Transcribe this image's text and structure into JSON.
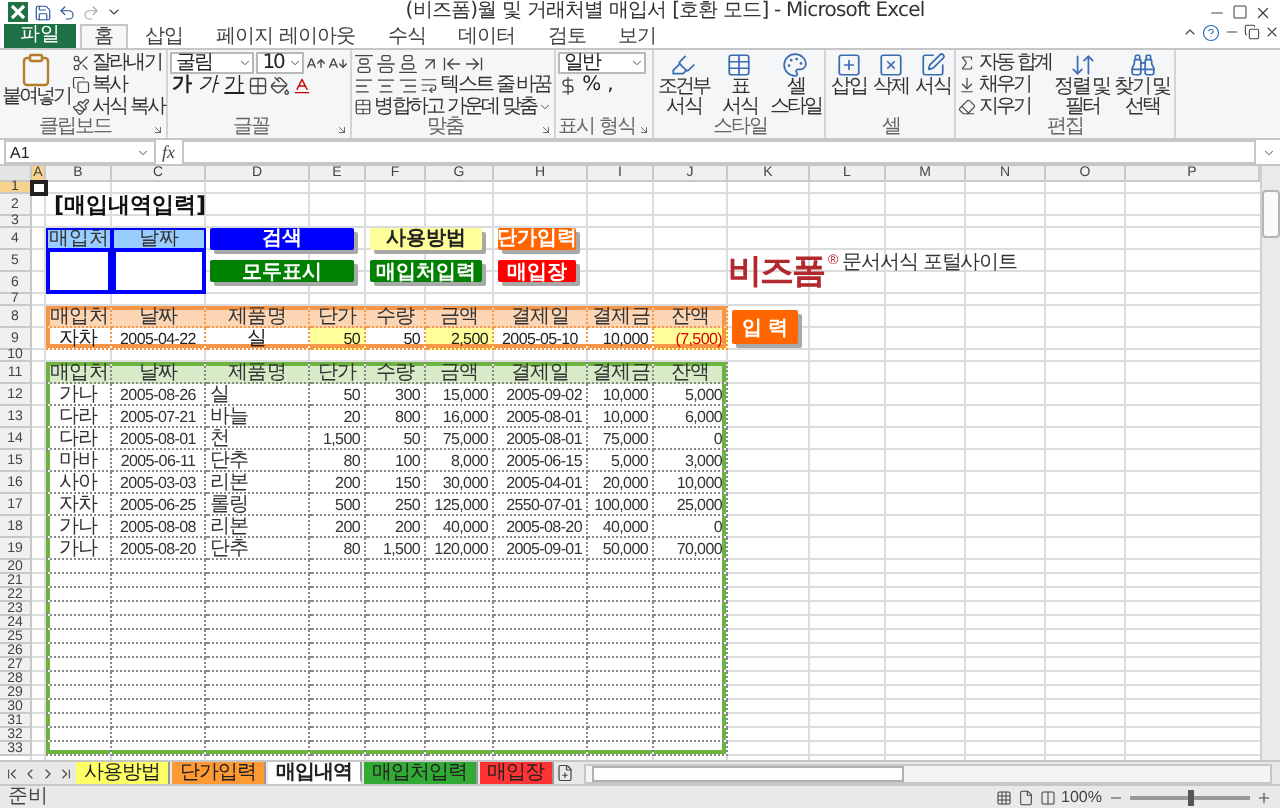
{
  "window": {
    "title": "(비즈폼)월 및 거래처별 매입서 [호환 모드] - Microsoft Excel"
  },
  "ribbon_tabs": [
    {
      "label": "파일",
      "kind": "file",
      "selected": false
    },
    {
      "label": "홈",
      "kind": "tab",
      "selected": true
    },
    {
      "label": "삽입",
      "kind": "tab",
      "selected": false
    },
    {
      "label": "페이지 레이아웃",
      "kind": "tab",
      "selected": false
    },
    {
      "label": "수식",
      "kind": "tab",
      "selected": false
    },
    {
      "label": "데이터",
      "kind": "tab",
      "selected": false
    },
    {
      "label": "검토",
      "kind": "tab",
      "selected": false
    },
    {
      "label": "보기",
      "kind": "tab",
      "selected": false
    }
  ],
  "ribbon_groups": [
    {
      "kind": "clipboard",
      "label": "클립보드",
      "paste": "붙여넣기",
      "items": [
        "잘라내기",
        "복사",
        "서식 복사"
      ]
    },
    {
      "kind": "font",
      "label": "글꼴",
      "font": "굴림",
      "size": "10",
      "styles": [
        "가",
        "가",
        "가"
      ]
    },
    {
      "kind": "align",
      "label": "맞춤",
      "wrap": "텍스트 줄 바꿈",
      "merge": "병합하고 가운데 맞춤"
    },
    {
      "kind": "number",
      "label": "표시 형식",
      "format": "일반",
      "percent": "%",
      "comma": ","
    },
    {
      "kind": "large",
      "label": "스타일",
      "items": [
        "조건부 서식",
        "표 서식",
        "셀 스타일"
      ]
    },
    {
      "kind": "large",
      "label": "셀",
      "items": [
        "삽입",
        "삭제",
        "서식"
      ]
    },
    {
      "kind": "editing",
      "label": "편집",
      "items": [
        "자동 합계",
        "채우기",
        "지우기"
      ],
      "large": [
        "정렬 및 필터",
        "찾기 및 선택"
      ]
    }
  ],
  "formula_bar": {
    "name_box": "A1",
    "fx": "fx"
  },
  "columns": [
    {
      "label": "A",
      "selected": true
    },
    {
      "label": "B",
      "selected": false
    },
    {
      "label": "C",
      "selected": false
    },
    {
      "label": "D",
      "selected": false
    },
    {
      "label": "E",
      "selected": false
    },
    {
      "label": "F",
      "selected": false
    },
    {
      "label": "G",
      "selected": false
    },
    {
      "label": "H",
      "selected": false
    },
    {
      "label": "I",
      "selected": false
    },
    {
      "label": "J",
      "selected": false
    },
    {
      "label": "K",
      "selected": false
    },
    {
      "label": "L",
      "selected": false
    },
    {
      "label": "M",
      "selected": false
    },
    {
      "label": "N",
      "selected": false
    },
    {
      "label": "O",
      "selected": false
    },
    {
      "label": "P",
      "selected": false
    }
  ],
  "rows": [
    {
      "label": "1",
      "selected": true
    },
    {
      "label": "2",
      "selected": false
    },
    {
      "label": "3",
      "selected": false
    },
    {
      "label": "4",
      "selected": false
    },
    {
      "label": "5",
      "selected": false
    },
    {
      "label": "6",
      "selected": false
    },
    {
      "label": "7",
      "selected": false
    },
    {
      "label": "8",
      "selected": false
    },
    {
      "label": "9",
      "selected": false
    },
    {
      "label": "10",
      "selected": false
    },
    {
      "label": "11",
      "selected": false
    },
    {
      "label": "12",
      "selected": false
    },
    {
      "label": "13",
      "selected": false
    },
    {
      "label": "14",
      "selected": false
    },
    {
      "label": "15",
      "selected": false
    },
    {
      "label": "16",
      "selected": false
    },
    {
      "label": "17",
      "selected": false
    },
    {
      "label": "18",
      "selected": false
    },
    {
      "label": "19",
      "selected": false
    },
    {
      "label": "20",
      "selected": false
    },
    {
      "label": "21",
      "selected": false
    },
    {
      "label": "22",
      "selected": false
    },
    {
      "label": "23",
      "selected": false
    },
    {
      "label": "24",
      "selected": false
    },
    {
      "label": "25",
      "selected": false
    },
    {
      "label": "26",
      "selected": false
    },
    {
      "label": "27",
      "selected": false
    },
    {
      "label": "28",
      "selected": false
    },
    {
      "label": "29",
      "selected": false
    },
    {
      "label": "30",
      "selected": false
    },
    {
      "label": "31",
      "selected": false
    },
    {
      "label": "32",
      "selected": false
    },
    {
      "label": "33",
      "selected": false
    }
  ],
  "sheet": {
    "title": "[매입내역입력]",
    "search_table": {
      "headers": [
        "매입처",
        "날짜"
      ]
    },
    "buttons": [
      {
        "label": "검색",
        "color": "#0000ff"
      },
      {
        "label": "사용방법",
        "color": "#ffff99"
      },
      {
        "label": "단가입력",
        "color": "#ff6600"
      },
      {
        "label": "모두표시",
        "color": "#008000"
      },
      {
        "label": "매입처입력",
        "color": "#008000"
      },
      {
        "label": "매입장",
        "color": "#ff0000"
      }
    ],
    "logo": {
      "name": "비즈폼",
      "mark": "®",
      "tagline": "문서서식 포털사이트"
    },
    "input_button": {
      "label": "입 력",
      "color": "#ff6600"
    },
    "input_table": {
      "headers": [
        "매입처",
        "날짜",
        "제품명",
        "단가",
        "수량",
        "금액",
        "결제일",
        "결제금",
        "잔액"
      ],
      "values": [
        {
          "text": "자차",
          "highlight": false,
          "negative": false
        },
        {
          "text": "2005-04-22",
          "highlight": false,
          "negative": false
        },
        {
          "text": "실",
          "highlight": false,
          "negative": false
        },
        {
          "text": "50",
          "highlight": true,
          "negative": false
        },
        {
          "text": "50",
          "highlight": false,
          "negative": false
        },
        {
          "text": "2,500",
          "highlight": true,
          "negative": false
        },
        {
          "text": "2005-05-10",
          "highlight": false,
          "negative": false
        },
        {
          "text": "10,000",
          "highlight": false,
          "negative": false
        },
        {
          "text": "(7,500)",
          "highlight": true,
          "negative": true
        }
      ]
    },
    "list_table": {
      "headers": [
        "매입처",
        "날짜",
        "제품명",
        "단가",
        "수량",
        "금액",
        "결제일",
        "결제금",
        "잔액"
      ],
      "rows": [
        [
          "가나",
          "2005-08-26",
          "실",
          "50",
          "300",
          "15,000",
          "2005-09-02",
          "10,000",
          "5,000"
        ],
        [
          "다라",
          "2005-07-21",
          "바늘",
          "20",
          "800",
          "16,000",
          "2005-08-01",
          "10,000",
          "6,000"
        ],
        [
          "다라",
          "2005-08-01",
          "천",
          "1,500",
          "50",
          "75,000",
          "2005-08-01",
          "75,000",
          "0"
        ],
        [
          "마바",
          "2005-06-11",
          "단추",
          "80",
          "100",
          "8,000",
          "2005-06-15",
          "5,000",
          "3,000"
        ],
        [
          "사아",
          "2005-03-03",
          "리본",
          "200",
          "150",
          "30,000",
          "2005-04-01",
          "20,000",
          "10,000"
        ],
        [
          "자차",
          "2005-06-25",
          "롤링",
          "500",
          "250",
          "125,000",
          "2550-07-01",
          "100,000",
          "25,000"
        ],
        [
          "가나",
          "2005-08-08",
          "리본",
          "200",
          "200",
          "40,000",
          "2005-08-20",
          "40,000",
          "0"
        ],
        [
          "가나",
          "2005-08-20",
          "단추",
          "80",
          "1,500",
          "120,000",
          "2005-09-01",
          "50,000",
          "70,000"
        ]
      ]
    }
  },
  "sheet_tabs": [
    {
      "label": "사용방법",
      "color": "#ffff66",
      "selected": false
    },
    {
      "label": "단가입력",
      "color": "#ff9933",
      "selected": false
    },
    {
      "label": "매입내역",
      "color": "#ffffff",
      "selected": true
    },
    {
      "label": "매입처입력",
      "color": "#33aa33",
      "selected": false
    },
    {
      "label": "매입장",
      "color": "#ff3333",
      "selected": false
    }
  ],
  "status_bar": {
    "status": "준비",
    "zoom": {
      "reading": "100%",
      "level": 0.5
    }
  }
}
